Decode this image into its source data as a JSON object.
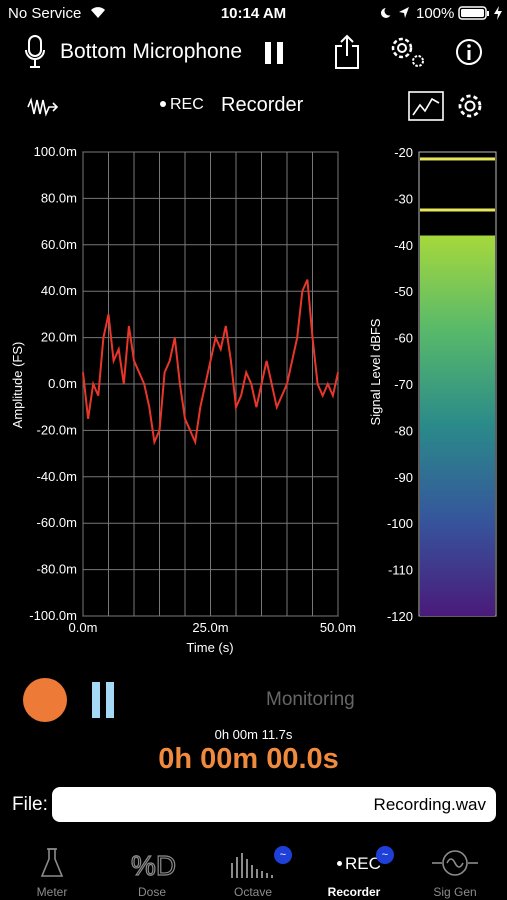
{
  "status_bar": {
    "carrier": "No Service",
    "time": "10:14 AM",
    "battery": "100%"
  },
  "header": {
    "source": "Bottom Microphone"
  },
  "subheader": {
    "rec_badge": "REC",
    "title": "Recorder"
  },
  "waveform": {
    "ylabel": "Amplitude (FS)",
    "xlabel": "Time (s)",
    "y_ticks": [
      "100.0m",
      "80.0m",
      "60.0m",
      "40.0m",
      "20.0m",
      "0.0m",
      "-20.0m",
      "-40.0m",
      "-60.0m",
      "-80.0m",
      "-100.0m"
    ],
    "x_ticks": [
      "0.0m",
      "25.0m",
      "50.0m"
    ]
  },
  "meter": {
    "ylabel": "Signal Level dBFS",
    "ticks": [
      "-20",
      "-30",
      "-40",
      "-50",
      "-60",
      "-70",
      "-80",
      "-90",
      "-100",
      "-110",
      "-120"
    ]
  },
  "chart_data": [
    {
      "type": "line",
      "ylabel": "Amplitude (FS)",
      "xlabel": "Time (s)",
      "xlim": [
        0,
        0.05
      ],
      "ylim": [
        -0.1,
        0.1
      ],
      "grid": true,
      "series": [
        {
          "color": "#e8362a",
          "x": [
            0,
            0.001,
            0.002,
            0.003,
            0.004,
            0.005,
            0.006,
            0.007,
            0.008,
            0.009,
            0.01,
            0.011,
            0.012,
            0.013,
            0.014,
            0.015,
            0.016,
            0.017,
            0.018,
            0.019,
            0.02,
            0.021,
            0.022,
            0.023,
            0.024,
            0.025,
            0.026,
            0.027,
            0.028,
            0.029,
            0.03,
            0.031,
            0.032,
            0.033,
            0.034,
            0.035,
            0.036,
            0.037,
            0.038,
            0.039,
            0.04,
            0.041,
            0.042,
            0.043,
            0.044,
            0.045,
            0.046,
            0.047,
            0.048,
            0.049,
            0.05
          ],
          "y": [
            0.005,
            -0.015,
            0.0,
            -0.005,
            0.02,
            0.03,
            0.01,
            0.015,
            0.0,
            0.025,
            0.01,
            0.005,
            0.0,
            -0.01,
            -0.025,
            -0.02,
            0.005,
            0.01,
            0.02,
            0.0,
            -0.015,
            -0.02,
            -0.025,
            -0.01,
            0.0,
            0.01,
            0.02,
            0.015,
            0.025,
            0.01,
            -0.01,
            -0.005,
            0.005,
            0.0,
            -0.01,
            0.0,
            0.01,
            0.0,
            -0.01,
            -0.005,
            0.0,
            0.01,
            0.02,
            0.04,
            0.045,
            0.02,
            0.0,
            -0.005,
            0.0,
            -0.005,
            0.005
          ]
        }
      ]
    },
    {
      "type": "bar",
      "ylabel": "Signal Level dBFS",
      "ylim": [
        -120,
        -20
      ],
      "values": [
        -38
      ],
      "markers": [
        -21.5,
        -32.5
      ]
    }
  ],
  "controls": {
    "monitoring": "Monitoring",
    "elapsed": "0h 00m 11.7s",
    "timer": "0h 00m 00.0s"
  },
  "file": {
    "label": "File:",
    "value": "Recording.wav"
  },
  "tabs": [
    {
      "label": "Meter"
    },
    {
      "label": "Dose"
    },
    {
      "label": "Octave"
    },
    {
      "label": "Recorder"
    },
    {
      "label": "Sig Gen"
    }
  ],
  "colors": {
    "accent": "#f08a3c",
    "trace": "#e8362a",
    "marker": "#e6e85a",
    "badge": "#1f3fd9"
  }
}
